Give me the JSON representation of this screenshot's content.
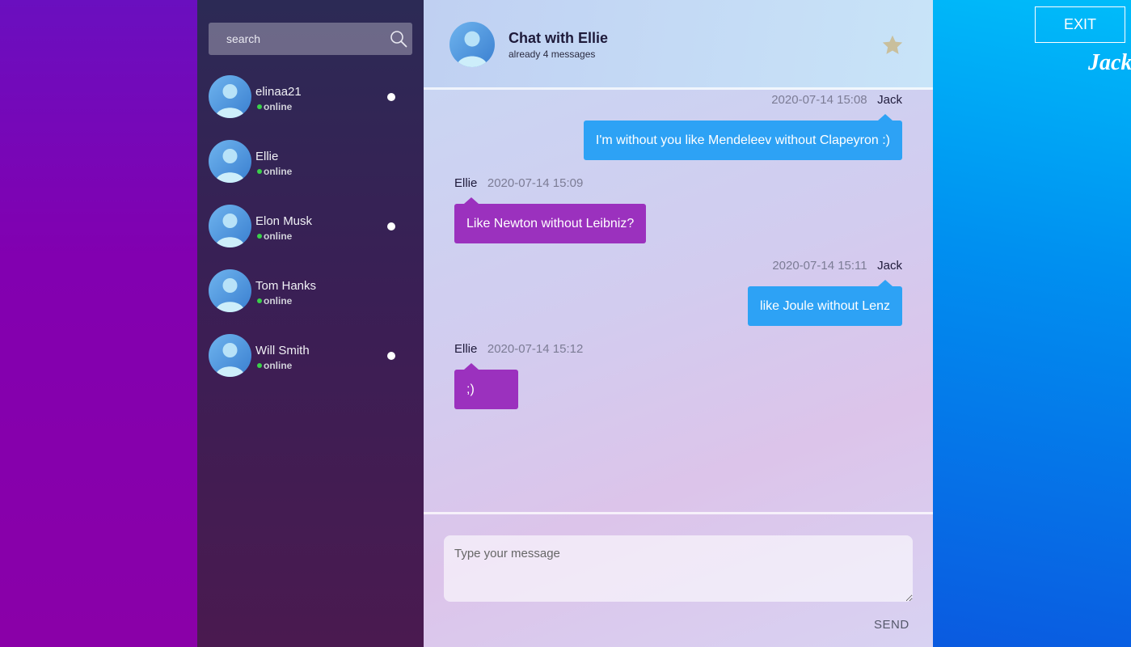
{
  "search": {
    "placeholder": "search"
  },
  "contacts": [
    {
      "name": "elinaa21",
      "status": "online",
      "unread": true
    },
    {
      "name": "Ellie",
      "status": "online",
      "unread": false
    },
    {
      "name": "Elon Musk",
      "status": "online",
      "unread": true
    },
    {
      "name": "Tom Hanks",
      "status": "online",
      "unread": false
    },
    {
      "name": "Will Smith",
      "status": "online",
      "unread": true
    }
  ],
  "chat": {
    "title": "Chat with Ellie",
    "subtitle": "already 4 messages",
    "messages": [
      {
        "author": "Jack",
        "timestamp": "2020-07-14 15:08",
        "text": "I'm without you like Mendeleev without Clapeyron :)",
        "direction": "out"
      },
      {
        "author": "Ellie",
        "timestamp": "2020-07-14 15:09",
        "text": "Like Newton without Leibniz?",
        "direction": "in"
      },
      {
        "author": "Jack",
        "timestamp": "2020-07-14 15:11",
        "text": "like Joule without Lenz",
        "direction": "out"
      },
      {
        "author": "Ellie",
        "timestamp": "2020-07-14 15:12",
        "text": ";)",
        "direction": "in"
      }
    ]
  },
  "composer": {
    "placeholder": "Type your message",
    "send_label": "SEND"
  },
  "user": {
    "exit_label": "EXIT",
    "name": "Jack"
  },
  "colors": {
    "outgoing": "#2da2f5",
    "incoming": "#9b31be",
    "online": "#3bd14a",
    "star": "#c9bf9c"
  }
}
